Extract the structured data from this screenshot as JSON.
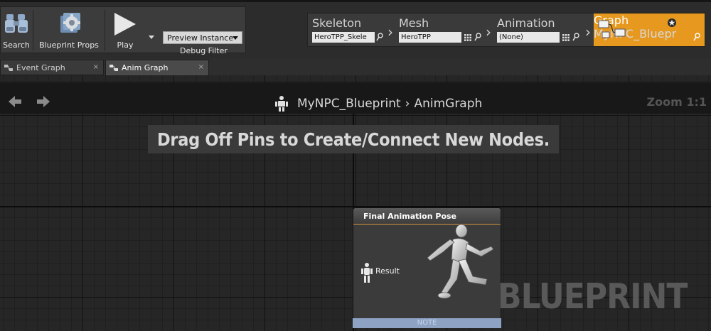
{
  "toolbar": {
    "search_label": "Search",
    "blueprint_props_label": "Blueprint Props",
    "play_label": "Play",
    "preview_instance_value": "Preview Instance",
    "debug_filter_label": "Debug Filter"
  },
  "modes": {
    "skeleton": {
      "title": "Skeleton",
      "value": "HeroTPP_Skele"
    },
    "mesh": {
      "title": "Mesh",
      "value": "HeroTPP"
    },
    "animation": {
      "title": "Animation",
      "value": "(None)"
    },
    "graph": {
      "title": "Graph",
      "value": "MyNPC_Bluepr"
    },
    "active_color": "#e6981f"
  },
  "tabs": [
    {
      "label": "Event Graph",
      "close": "×"
    },
    {
      "label": "Anim Graph",
      "close": "×"
    }
  ],
  "graph": {
    "breadcrumb_root": "MyNPC_Blueprint",
    "breadcrumb_sep": "›",
    "breadcrumb_leaf": "AnimGraph",
    "zoom_label": "Zoom 1:1",
    "hint": "Drag Off Pins to Create/Connect New Nodes.",
    "watermark": "BLUEPRINT"
  },
  "node": {
    "title": "Final Animation Pose",
    "pin_label": "Result",
    "note_label": "NOTE"
  }
}
